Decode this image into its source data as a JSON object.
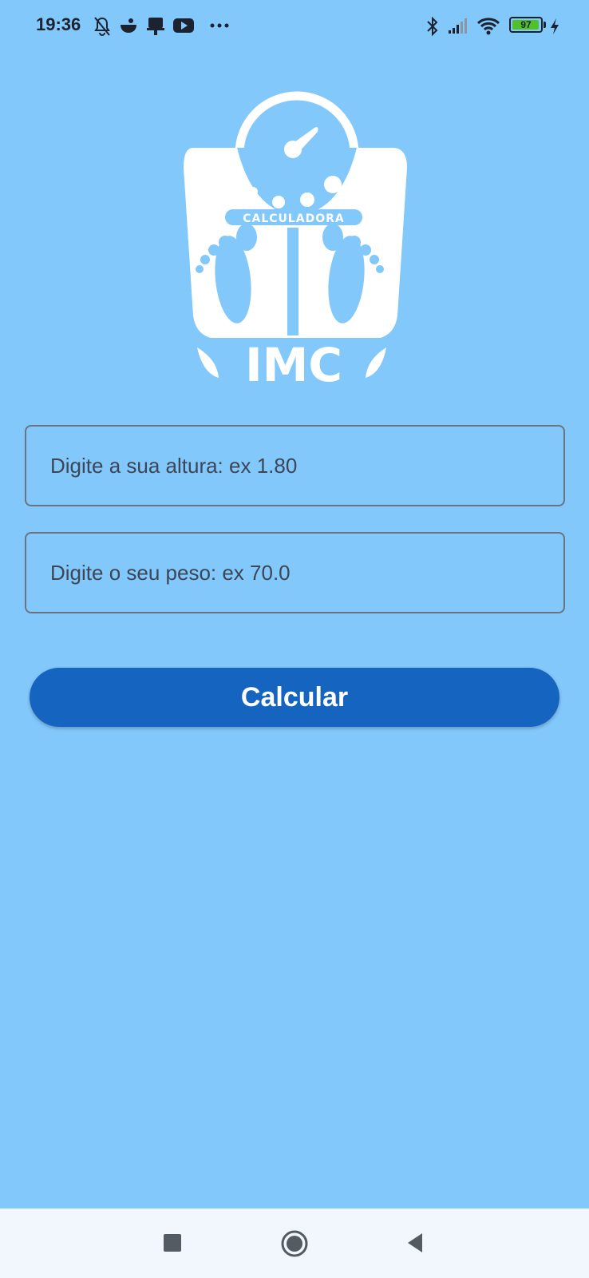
{
  "status_bar": {
    "time": "19:36",
    "battery_level": 97,
    "battery_label": "97",
    "icons": [
      "mute-icon",
      "app-icon",
      "notification-icon",
      "youtube-icon",
      "more-icon",
      "bluetooth-icon",
      "signal-icon",
      "wifi-icon",
      "battery-icon",
      "charging-icon"
    ]
  },
  "logo": {
    "banner_text": "CALCULADORA",
    "title_text": "IMC"
  },
  "form": {
    "height_placeholder": "Digite a sua altura: ex 1.80",
    "height_value": "",
    "weight_placeholder": "Digite o seu peso: ex 70.0",
    "weight_value": "",
    "calculate_label": "Calcular"
  },
  "nav_bar": {
    "icons": [
      "recents-icon",
      "home-icon",
      "back-icon"
    ]
  },
  "colors": {
    "background": "#82c8fb",
    "button": "#1565c0",
    "battery": "#52c02a"
  }
}
